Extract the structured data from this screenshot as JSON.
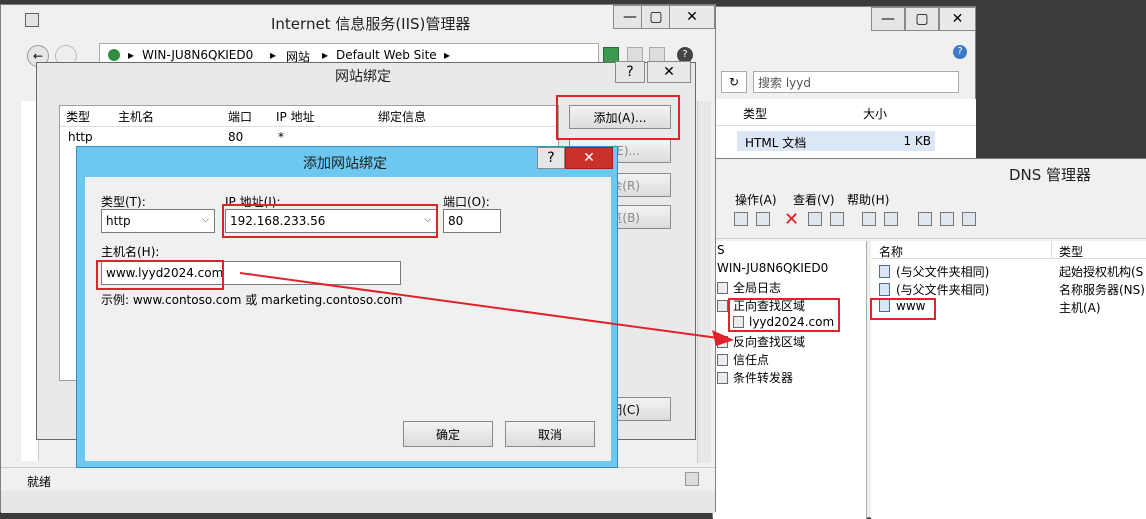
{
  "iis": {
    "title": "Internet 信息服务(IIS)管理器",
    "breadcrumb": [
      "WIN-JU8N6QKIED0",
      "网站",
      "Default Web Site"
    ],
    "status": "就绪"
  },
  "explorer": {
    "search_placeholder": "搜索 lyyd",
    "columns": [
      "类型",
      "大小"
    ],
    "row": {
      "type": "HTML 文档",
      "size": "1 KB"
    }
  },
  "site_bindings": {
    "title": "网站绑定",
    "columns": [
      "类型",
      "主机名",
      "端口",
      "IP 地址",
      "绑定信息"
    ],
    "row": {
      "type": "http",
      "hostname": "",
      "port": "80",
      "ip": "*"
    },
    "buttons": {
      "add": "添加(A)...",
      "edit": "(E)...",
      "remove": "余(R)",
      "browse": "览(B)",
      "close": "闭(C)"
    }
  },
  "add_binding": {
    "title": "添加网站绑定",
    "type_label": "类型(T):",
    "type_value": "http",
    "ip_label": "IP 地址(I):",
    "ip_value": "192.168.233.56",
    "port_label": "端口(O):",
    "port_value": "80",
    "host_label": "主机名(H):",
    "host_value": "www.lyyd2024.com",
    "example": "示例: www.contoso.com 或 marketing.contoso.com",
    "ok": "确定",
    "cancel": "取消"
  },
  "dns": {
    "title": "DNS 管理器",
    "menu": [
      "操作(A)",
      "查看(V)",
      "帮助(H)"
    ],
    "tree": {
      "root_partial": "S",
      "server": "WIN-JU8N6QKIED0",
      "items": [
        "全局日志",
        "正向查找区域",
        "lyyd2024.com",
        "反向查找区域",
        "信任点",
        "条件转发器"
      ]
    },
    "list": {
      "columns": [
        "名称",
        "类型"
      ],
      "rows": [
        {
          "name": "(与父文件夹相同)",
          "type": "起始授权机构(S"
        },
        {
          "name": "(与父文件夹相同)",
          "type": "名称服务器(NS)"
        },
        {
          "name": "www",
          "type": "主机(A)"
        }
      ]
    }
  },
  "colors": {
    "highlight": "#e0232a",
    "dialog_title": "#6cc8ef",
    "arrow": "#e0232a"
  }
}
